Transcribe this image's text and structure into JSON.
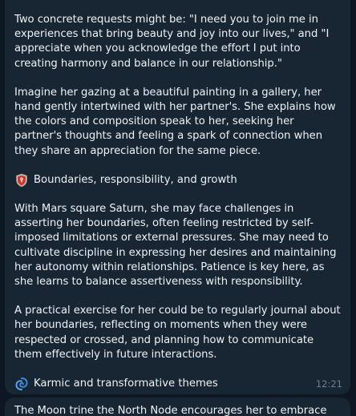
{
  "message": {
    "p1": "Two concrete requests might be: \"I need you to join me in experiences that bring beauty and joy into our lives,\" and \"I appreciate when you acknowledge the effort I put into creating harmony and balance in our relationship.\"",
    "p2": "Imagine her gazing at a beautiful painting in a gallery, her hand gently intertwined with her partner's. She explains how the colors and composition speak to her, seeking her partner's thoughts and feeling a spark of connection when they share an appreciation for the same piece.",
    "section1": {
      "icon": "shield-icon",
      "title": "Boundaries, responsibility, and growth"
    },
    "p3": "With Mars square Saturn, she may face challenges in asserting her boundaries, often feeling restricted by self-imposed limitations or external pressures. She may need to cultivate discipline in expressing her desires and maintaining her autonomy within relationships. Patience is key here, as she learns to balance assertiveness with responsibility.",
    "p4": "A practical exercise for her could be to regularly journal about her boundaries, reflecting on moments when they were respected or crossed, and planning how to communicate them effectively in future interactions.",
    "section2": {
      "icon": "cyclone-icon",
      "title": "Karmic and transformative themes"
    },
    "time": "12:21"
  },
  "next_message": {
    "text": "The Moon trine the North Node encourages her to embrace"
  },
  "colors": {
    "background": "#0e1621",
    "bubble": "#182533",
    "text": "#eef2f6",
    "timestamp": "#6d7f8f"
  }
}
